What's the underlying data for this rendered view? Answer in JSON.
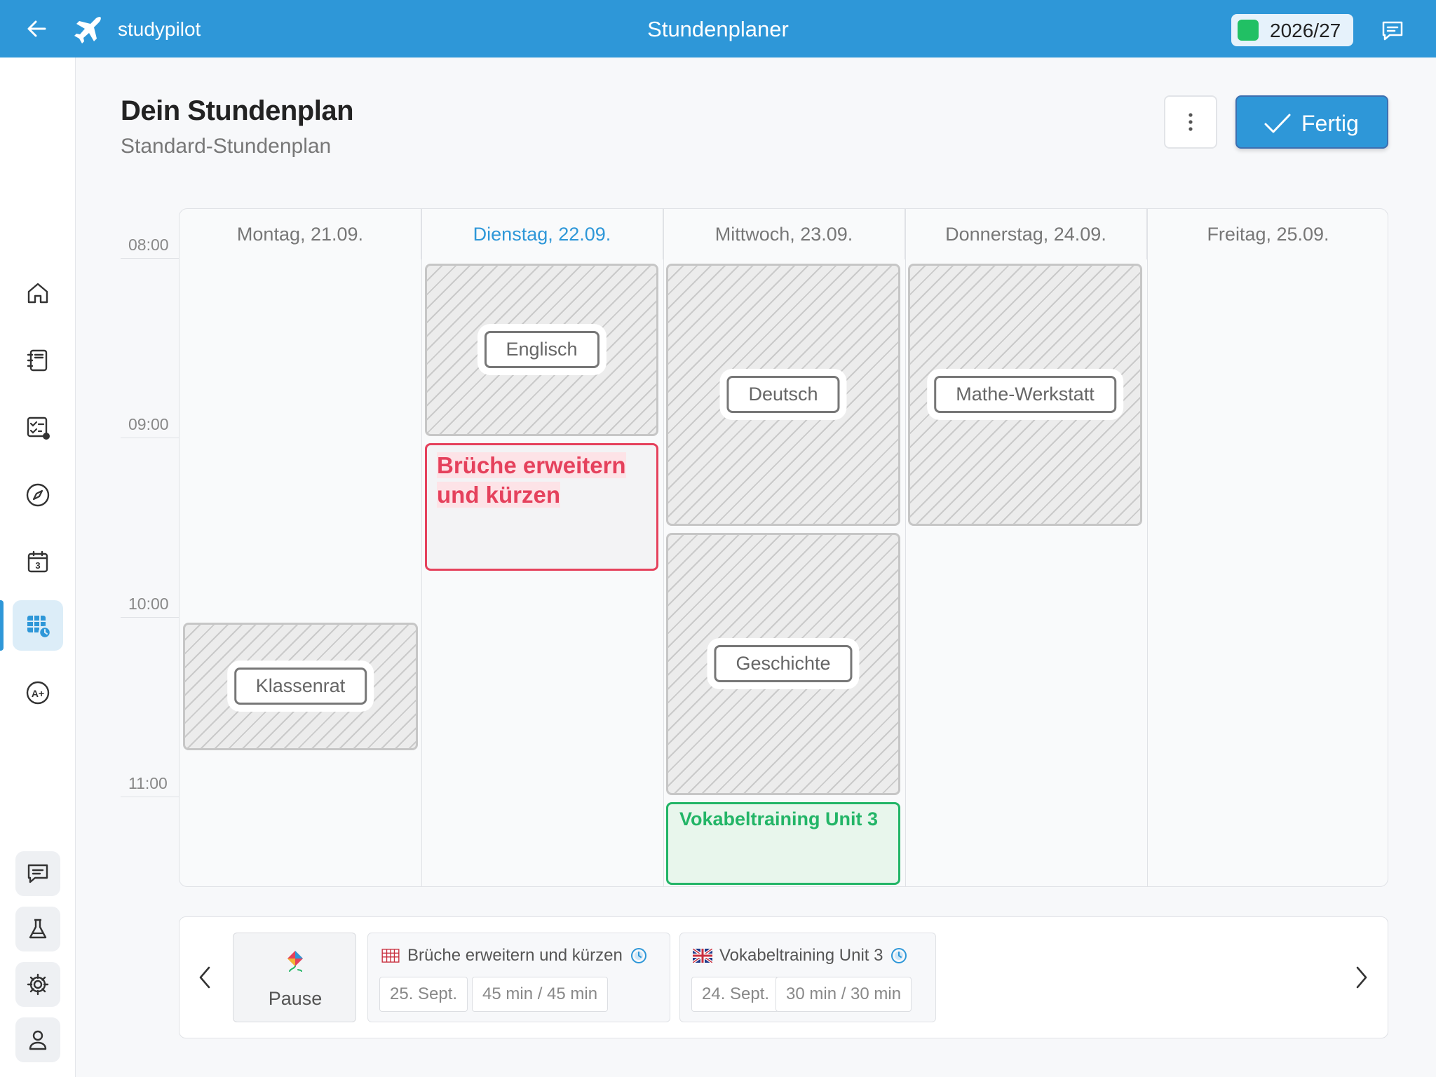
{
  "topbar": {
    "brand": "studypilot",
    "title": "Stundenplaner",
    "school_year": "2026/27",
    "colors": {
      "bar": "#2e97d8",
      "year_dot": "#21c064"
    }
  },
  "sidebar": {
    "items": [
      {
        "icon": "home-icon"
      },
      {
        "icon": "notebook-icon"
      },
      {
        "icon": "checklist-icon"
      },
      {
        "icon": "compass-icon"
      },
      {
        "icon": "calendar-day-icon",
        "label": "3"
      },
      {
        "icon": "timetable-icon",
        "active": true
      },
      {
        "icon": "grades-icon",
        "label": "A+"
      }
    ],
    "bottom": [
      {
        "icon": "chat-icon"
      },
      {
        "icon": "flask-icon"
      },
      {
        "icon": "settings-icon"
      },
      {
        "icon": "profile-icon"
      }
    ]
  },
  "header": {
    "title": "Dein Stundenplan",
    "subtitle": "Standard-Stundenplan",
    "done_label": "Fertig"
  },
  "calendar": {
    "days": [
      {
        "label": "Montag, 21.09.",
        "today": false
      },
      {
        "label": "Dienstag, 22.09.",
        "today": true
      },
      {
        "label": "Mittwoch, 23.09.",
        "today": false
      },
      {
        "label": "Donnerstag, 24.09.",
        "today": false
      },
      {
        "label": "Freitag, 25.09.",
        "today": false
      }
    ],
    "times": [
      "08:00",
      "09:00",
      "10:00",
      "11:00"
    ],
    "lessons": [
      {
        "subject": "Englisch",
        "day": "Dienstag",
        "start": "08:00",
        "end": "09:00"
      },
      {
        "subject": "Deutsch",
        "day": "Mittwoch",
        "start": "08:00",
        "end": "09:30"
      },
      {
        "subject": "Mathe-Werkstatt",
        "day": "Donnerstag",
        "start": "08:00",
        "end": "09:30"
      },
      {
        "subject": "Geschichte",
        "day": "Mittwoch",
        "start": "09:30",
        "end": "11:00"
      },
      {
        "subject": "Klassenrat",
        "day": "Montag",
        "start": "10:00",
        "end": "10:45"
      }
    ],
    "tasks": [
      {
        "title": "Brüche erweitern und kürzen",
        "day": "Dienstag",
        "start": "09:00",
        "end": "09:45",
        "color": "#e5415c"
      },
      {
        "title": "Vokabeltraining Unit 3",
        "day": "Mittwoch",
        "start": "11:00",
        "end": "11:30",
        "color": "#23b567"
      }
    ]
  },
  "tray": {
    "pause_label": "Pause",
    "cards": [
      {
        "flag": "calendar-flag-icon",
        "title": "Brüche erweitern und kürzen",
        "date": "25. Sept.",
        "duration": "45 min / 45 min"
      },
      {
        "flag": "uk-flag-icon",
        "title": "Vokabeltraining Unit 3",
        "date": "24. Sept.",
        "duration": "30 min / 30 min"
      }
    ]
  }
}
